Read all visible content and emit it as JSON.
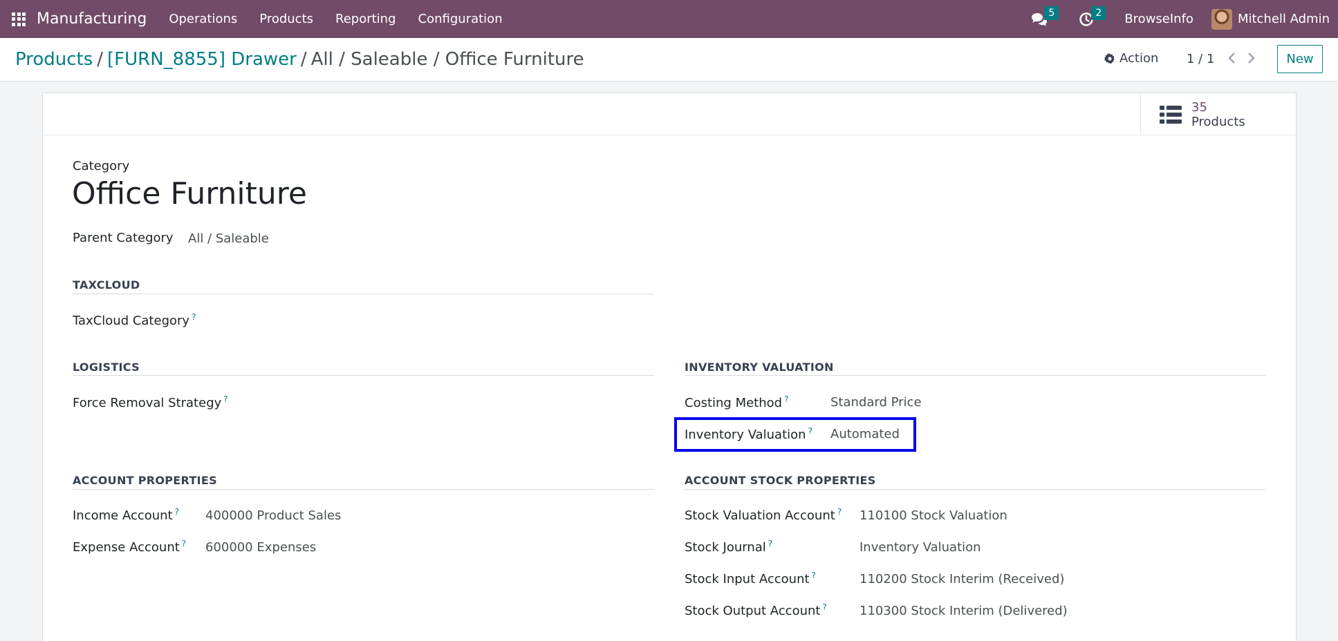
{
  "navbar": {
    "app_name": "Manufacturing",
    "menu": [
      "Operations",
      "Products",
      "Reporting",
      "Configuration"
    ],
    "messages_count": "5",
    "activities_count": "2",
    "company": "BrowseInfo",
    "user": "Mitchell Admin",
    "colors": {
      "background": "#714b67",
      "badge": "#017e84"
    }
  },
  "control": {
    "breadcrumb": {
      "root": "Products",
      "parent": "[FURN_8855] Drawer",
      "current": "All / Saleable / Office Furniture"
    },
    "action_label": "Action",
    "pager": "1 / 1",
    "new_label": "New"
  },
  "stat_button": {
    "value": "35",
    "label": "Products",
    "icon": "list-icon"
  },
  "form": {
    "category_label": "Category",
    "title": "Office Furniture",
    "parent_category_label": "Parent Category",
    "parent_category_value": "All / Saleable",
    "help_marker": "?",
    "taxcloud": {
      "section": "TAXCLOUD",
      "category_label": "TaxCloud Category"
    },
    "logistics": {
      "section": "LOGISTICS",
      "removal_label": "Force Removal Strategy"
    },
    "inventory_valuation": {
      "section": "INVENTORY VALUATION",
      "costing_label": "Costing Method",
      "costing_value": "Standard Price",
      "valuation_label": "Inventory Valuation",
      "valuation_value": "Automated"
    },
    "account_properties": {
      "section": "ACCOUNT PROPERTIES",
      "income_label": "Income Account",
      "income_value": "400000 Product Sales",
      "expense_label": "Expense Account",
      "expense_value": "600000 Expenses"
    },
    "account_stock_properties": {
      "section": "ACCOUNT STOCK PROPERTIES",
      "valuation_account_label": "Stock Valuation Account",
      "valuation_account_value": "110100 Stock Valuation",
      "journal_label": "Stock Journal",
      "journal_value": "Inventory Valuation",
      "input_label": "Stock Input Account",
      "input_value": "110200 Stock Interim (Received)",
      "output_label": "Stock Output Account",
      "output_value": "110300 Stock Interim (Delivered)"
    }
  }
}
